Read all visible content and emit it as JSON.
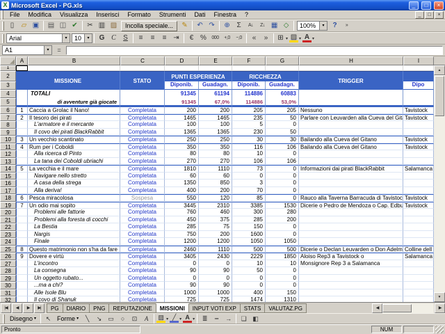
{
  "window": {
    "title": "Microsoft Excel - PG.xls",
    "app_icon": "X",
    "controls": {
      "minimize": "_",
      "maximize": "□",
      "close": "×"
    }
  },
  "menu": {
    "items": [
      "File",
      "Modifica",
      "Visualizza",
      "Inserisci",
      "Formato",
      "Strumenti",
      "Dati",
      "Finestra",
      "?"
    ]
  },
  "toolbar": {
    "paste_special_label": "Incolla speciale...",
    "zoom_value": "100%",
    "font_name": "Arial",
    "font_size": "10",
    "standard_icons_a": [
      {
        "name": "new-document-icon",
        "glyph": "▯"
      },
      {
        "name": "open-folder-icon",
        "glyph": "▱",
        "color": "#b8860b"
      },
      {
        "name": "save-icon",
        "glyph": "▣",
        "color": "#2d4fa0"
      },
      {
        "sep": true
      },
      {
        "name": "print-icon",
        "glyph": "▤",
        "color": "#555555"
      },
      {
        "name": "print-preview-icon",
        "glyph": "◫",
        "color": "#555555"
      },
      {
        "name": "spelling-icon",
        "glyph": "✔",
        "color": "#2d7a2d"
      },
      {
        "sep": true
      },
      {
        "name": "cut-icon",
        "glyph": "✂"
      },
      {
        "name": "copy-icon",
        "glyph": "▥"
      },
      {
        "name": "paste-icon",
        "glyph": "▨",
        "color": "#8a6a3a"
      }
    ],
    "standard_icons_b": [
      {
        "name": "format-painter-icon",
        "glyph": "✎",
        "color": "#b8860b"
      },
      {
        "sep": true
      },
      {
        "name": "undo-icon",
        "glyph": "↶",
        "color": "#2d4fa0"
      },
      {
        "name": "redo-icon",
        "glyph": "↷",
        "color": "#2d4fa0"
      },
      {
        "sep": true
      },
      {
        "name": "insert-hyperlink-icon",
        "glyph": "⊕",
        "color": "#2d4fa0"
      },
      {
        "name": "autosum-icon",
        "glyph": "Σ"
      },
      {
        "name": "sort-ascending-icon",
        "glyph": "A↓",
        "cls": "small"
      },
      {
        "name": "sort-descending-icon",
        "glyph": "Z↓",
        "cls": "small"
      },
      {
        "name": "chart-wizard-icon",
        "glyph": "▦",
        "color": "#2d4fa0"
      },
      {
        "name": "drawing-icon",
        "glyph": "◇",
        "color": "#2d7a2d"
      },
      {
        "sep": true
      }
    ],
    "standard_icons_c": [
      {
        "name": "help-icon",
        "glyph": "?",
        "color": "#2d4fa0",
        "cls": "boldg"
      },
      {
        "name": "toolbar-options-icon",
        "glyph": "»",
        "cls": "small"
      }
    ],
    "formatting_icons": [
      {
        "name": "bold-icon",
        "glyph": "G",
        "cls": "boldg"
      },
      {
        "name": "italic-icon",
        "glyph": "C",
        "cls": "italg"
      },
      {
        "name": "underline-icon",
        "glyph": "S",
        "cls": "undg"
      },
      {
        "sep": true
      },
      {
        "name": "align-left-icon",
        "glyph": "≡"
      },
      {
        "name": "align-center-icon",
        "glyph": "≡"
      },
      {
        "name": "align-right-icon",
        "glyph": "≡"
      },
      {
        "name": "merge-center-icon",
        "glyph": "⇥"
      },
      {
        "sep": true
      },
      {
        "name": "currency-icon",
        "glyph": "€"
      },
      {
        "name": "percent-icon",
        "glyph": "%"
      },
      {
        "name": "thousands-icon",
        "glyph": "000",
        "cls": "small"
      },
      {
        "name": "increase-decimal-icon",
        "glyph": "+,0",
        "cls": "small"
      },
      {
        "name": "decrease-decimal-icon",
        "glyph": "−,0",
        "cls": "small"
      },
      {
        "sep": true
      },
      {
        "name": "decrease-indent-icon",
        "glyph": "«"
      },
      {
        "name": "increase-indent-icon",
        "glyph": "»"
      },
      {
        "sep": true
      },
      {
        "name": "borders-icon",
        "glyph": "⊞",
        "dd": true
      },
      {
        "name": "fill-color-icon",
        "glyph": "▨",
        "bar": "#ffd700",
        "dd": true
      },
      {
        "name": "font-color-icon",
        "glyph": "A",
        "bar": "#cc2222",
        "cls": "boldg",
        "dd": true
      }
    ]
  },
  "formula_bar": {
    "name_box": "A1",
    "equals": "=",
    "formula": ""
  },
  "columns": [
    "A",
    "B",
    "C",
    "D",
    "E",
    "F",
    "G",
    "H",
    "I"
  ],
  "row_numbers": [
    1,
    2,
    3,
    4,
    5,
    6,
    7,
    8,
    9,
    10,
    11,
    12,
    13,
    14,
    15,
    16,
    17,
    18,
    19,
    20,
    21,
    22,
    23,
    24,
    25,
    26,
    27,
    28,
    29,
    30,
    31,
    32
  ],
  "sheet": {
    "header": {
      "missione": "MISSIONE",
      "stato": "STATO",
      "punti": "PUNTI ESPERIENZA",
      "ricchezza": "RICCHEZZA",
      "trigger": "TRIGGER",
      "sub": [
        "Diponib.",
        "Guadagn.",
        "Diponib.",
        "Guadagn."
      ],
      "partial_right": "Dipo"
    },
    "totals": {
      "label": "TOTALI",
      "values": [
        "91345",
        "61194",
        "114886",
        "60883"
      ]
    },
    "played": {
      "label": "di avventure già giocate",
      "values": [
        "91345",
        "67,0%",
        "114886",
        "53,0%"
      ]
    },
    "rows": [
      {
        "n": "1",
        "title": "Caccia a Grolac il Nano!",
        "sub": false,
        "status": "Completata",
        "d": "200",
        "e": "200",
        "f": "205",
        "g": "205",
        "trigger": "Nessuno",
        "place": "Tavistock"
      },
      {
        "n": "2",
        "title": "Il tesoro dei pirati",
        "sub": false,
        "status": "Completata",
        "d": "1465",
        "e": "1465",
        "f": "235",
        "g": "50",
        "trigger": "Parlare con Leuvarden alla Cueva del Gitano",
        "place": "Tavistock"
      },
      {
        "title": "L'armatore e il mercante",
        "sub": true,
        "status": "Completata",
        "d": "100",
        "e": "100",
        "f": "5",
        "g": "0"
      },
      {
        "title": "Il covo dei pirati BlackRabbit",
        "sub": true,
        "status": "Completata",
        "d": "1365",
        "e": "1365",
        "f": "230",
        "g": "50"
      },
      {
        "n": "3",
        "title": "Un vecchio scantinato",
        "sub": false,
        "status": "Completata",
        "d": "250",
        "e": "250",
        "f": "30",
        "g": "30",
        "trigger": "Bailando alla Cueva del Gitano",
        "place": "Tavistock"
      },
      {
        "n": "4",
        "title": "Rum per i Coboldi",
        "sub": false,
        "status": "Completata",
        "d": "350",
        "e": "350",
        "f": "116",
        "g": "106",
        "trigger": "Bailando alla Cueva del Gitano",
        "place": "Tavistock"
      },
      {
        "title": "Alla ricerca di Pinto",
        "sub": true,
        "status": "Completata",
        "d": "80",
        "e": "80",
        "f": "10",
        "g": "0"
      },
      {
        "title": "La tana dei Coboldi ubriachi",
        "sub": true,
        "status": "Completata",
        "d": "270",
        "e": "270",
        "f": "106",
        "g": "106"
      },
      {
        "n": "5",
        "title": "La vecchia e il mare",
        "sub": false,
        "status": "Completata",
        "d": "1810",
        "e": "1110",
        "f": "73",
        "g": "0",
        "trigger": "Informazioni dai pirati BlackRabbit",
        "place": "Salamanca"
      },
      {
        "title": "Navigare nello stretto",
        "sub": true,
        "status": "Completata",
        "d": "60",
        "e": "60",
        "f": "0",
        "g": "0"
      },
      {
        "title": "A casa della strega",
        "sub": true,
        "status": "Completata",
        "d": "1350",
        "e": "850",
        "f": "3",
        "g": "0"
      },
      {
        "title": "Alla deriva!",
        "sub": true,
        "status": "Completata",
        "d": "400",
        "e": "200",
        "f": "70",
        "g": "0"
      },
      {
        "n": "6",
        "title": "Pesca miracolosa",
        "sub": false,
        "status": "Sospesa",
        "muted": true,
        "d": "550",
        "e": "120",
        "f": "85",
        "g": "0",
        "trigger": "Rauco alla Taverna Barracuda di Tavistock",
        "place": "Tavistock"
      },
      {
        "n": "7",
        "title": "Un odio mai sopito",
        "sub": false,
        "status": "Completata",
        "d": "3445",
        "e": "2310",
        "f": "3385",
        "g": "1530",
        "trigger": "Dicerie o Pedro de Mendoza o Cap. Edburg",
        "place": "Tavistock"
      },
      {
        "title": "Problemi alle fattorie",
        "sub": true,
        "status": "Completata",
        "d": "760",
        "e": "460",
        "f": "300",
        "g": "280"
      },
      {
        "title": "Problemi alla foresta di cocchi",
        "sub": true,
        "status": "Completata",
        "d": "450",
        "e": "375",
        "f": "285",
        "g": "200"
      },
      {
        "title": "La Bestia",
        "sub": true,
        "status": "Completata",
        "d": "285",
        "e": "75",
        "f": "150",
        "g": "0"
      },
      {
        "title": "Nargis",
        "sub": true,
        "status": "Completata",
        "d": "750",
        "e": "200",
        "f": "1600",
        "g": "0"
      },
      {
        "title": "Finale",
        "sub": true,
        "status": "Completata",
        "d": "1200",
        "e": "1200",
        "f": "1050",
        "g": "1050"
      },
      {
        "n": "8",
        "title": "Questo matrimonio non s'ha da fare",
        "sub": false,
        "status": "Completata",
        "d": "2460",
        "e": "1110",
        "f": "500",
        "g": "500",
        "trigger": "Dicerie o Declan Leuvarden o Don Adelmo",
        "place": "Colline dell"
      },
      {
        "n": "9",
        "title": "Dovere e virtù",
        "sub": false,
        "status": "Completata",
        "d": "3405",
        "e": "2430",
        "f": "2229",
        "g": "1850",
        "trigger": "Aloiso Rep3 a Tavistock o",
        "place": "Salamanca"
      },
      {
        "title": "L'incontro",
        "sub": true,
        "status": "Completata",
        "d": "0",
        "e": "0",
        "f": "10",
        "g": "10",
        "trigger": "Monsignore Rep 3 a Salamanca"
      },
      {
        "title": "La consegna",
        "sub": true,
        "status": "Completata",
        "d": "90",
        "e": "90",
        "f": "50",
        "g": "0"
      },
      {
        "title": "Un oggetto rubato...",
        "sub": true,
        "status": "Completata",
        "d": "0",
        "e": "0",
        "f": "0",
        "g": "0"
      },
      {
        "title": "...ma a chi?",
        "sub": true,
        "status": "Completata",
        "d": "90",
        "e": "90",
        "f": "0",
        "g": "0"
      },
      {
        "title": "Alle Isole Blu",
        "sub": true,
        "status": "Completata",
        "d": "1000",
        "e": "1000",
        "f": "400",
        "g": "150"
      },
      {
        "title": "Il covo di Shanuk",
        "sub": true,
        "status": "Completata",
        "d": "725",
        "e": "725",
        "f": "1474",
        "g": "1310"
      }
    ]
  },
  "tabs": {
    "nav": [
      "|◀",
      "◀",
      "▶",
      "▶|"
    ],
    "items": [
      "PG",
      "DIARIO",
      "PNG",
      "REPUTAZIONE",
      "MISSIONI",
      "INPUT VOTI EXP",
      "STATS",
      "VALUTAZ.PG"
    ],
    "active": "MISSIONI"
  },
  "drawing": {
    "label": "Disegno",
    "shapes_label": "Forme",
    "icons_a": [
      {
        "name": "select-arrow-icon",
        "glyph": "↖"
      }
    ],
    "icons_b": [
      {
        "name": "draw-line-icon",
        "glyph": "╲"
      },
      {
        "name": "draw-arrow-icon",
        "glyph": "↘"
      },
      {
        "name": "draw-rectangle-icon",
        "glyph": "▭"
      },
      {
        "name": "draw-oval-icon",
        "glyph": "○"
      },
      {
        "name": "text-box-icon",
        "glyph": "⊡"
      },
      {
        "name": "wordart-icon",
        "glyph": "A",
        "cls": "italg"
      },
      {
        "sep": true
      },
      {
        "name": "draw-fill-color-icon",
        "glyph": "▨",
        "bar": "#ffd700",
        "dd": true
      },
      {
        "name": "draw-line-color-icon",
        "glyph": "╱",
        "bar": "#5566cc",
        "dd": true
      },
      {
        "name": "draw-font-color-icon",
        "glyph": "A",
        "bar": "#cc2222",
        "cls": "boldg",
        "dd": true
      },
      {
        "sep": true
      },
      {
        "name": "line-style-icon",
        "glyph": "≣"
      },
      {
        "name": "dash-style-icon",
        "glyph": "┅"
      },
      {
        "name": "arrow-style-icon",
        "glyph": "→"
      },
      {
        "sep": true
      },
      {
        "name": "shadow-icon",
        "glyph": "❏"
      },
      {
        "name": "three-d-icon",
        "glyph": "◧"
      }
    ]
  },
  "status": {
    "left": "Pronto",
    "right": "NUM"
  },
  "icons": {
    "dropdown": "▾",
    "scroll_up": "▲",
    "scroll_down": "▼",
    "scroll_left": "◀",
    "scroll_right": "▶"
  },
  "colors": {
    "header_fill": "#3A64C4",
    "table_border": "#3A64C4",
    "status_completed": "#2238C8",
    "status_suspended": "#9A9A9A",
    "totals_value": "#2233CC",
    "played_value": "#993366"
  }
}
